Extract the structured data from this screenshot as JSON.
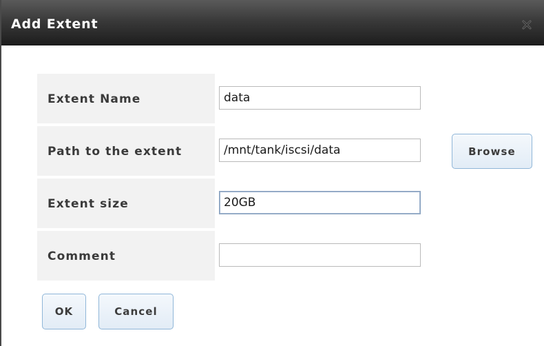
{
  "dialog": {
    "title": "Add Extent",
    "close_icon": "close-icon"
  },
  "form": {
    "extent_name": {
      "label": "Extent Name",
      "value": "data"
    },
    "path": {
      "label": "Path to the extent",
      "value": "/mnt/tank/iscsi/data",
      "browse_label": "Browse"
    },
    "extent_size": {
      "label": "Extent size",
      "value": "20GB"
    },
    "comment": {
      "label": "Comment",
      "value": ""
    }
  },
  "actions": {
    "ok_label": "OK",
    "cancel_label": "Cancel"
  },
  "colors": {
    "titlebar": "#2a2a2a",
    "label_bg": "#f2f2f2",
    "button_border": "#8fb6d8",
    "button_bg": "#e8f0f8"
  }
}
